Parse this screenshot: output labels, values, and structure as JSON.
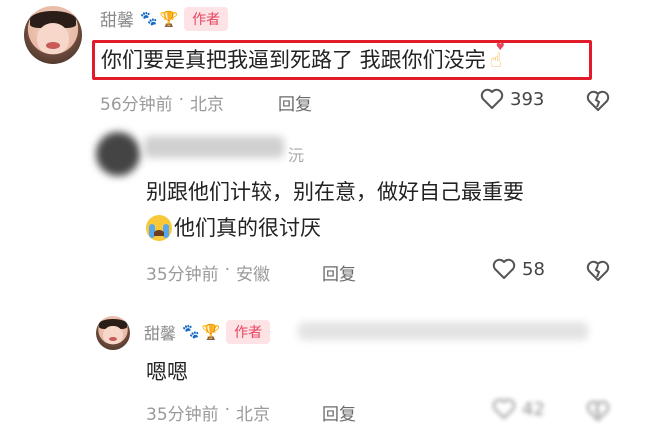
{
  "comments": [
    {
      "username": "甜馨",
      "author_label": "作者",
      "text": "你们要是真把我逼到死路了 我跟你们没完",
      "time": "56分钟前",
      "dot": "·",
      "location": "北京",
      "reply_label": "回复",
      "likes": "393"
    },
    {
      "username_partial": "沅",
      "text_line1": "别跟他们计较，别在意，做好自己最重要",
      "text_line2": "他们真的很讨厌",
      "time": "35分钟前",
      "dot": "·",
      "location": "安徽",
      "reply_label": "回复",
      "likes": "58"
    },
    {
      "username": "甜馨",
      "author_label": "作者",
      "text": "嗯嗯",
      "time": "35分钟前",
      "dot": "·",
      "location": "北京",
      "reply_label": "回复",
      "likes": "42"
    }
  ],
  "colors": {
    "highlight_border": "#e21b2b",
    "author_badge_bg": "#fde2e6",
    "author_badge_text": "#e8455f"
  },
  "icons": [
    "paw-icon",
    "trophy-icon",
    "heart-icon",
    "broken-heart-icon",
    "crying-emoji-icon",
    "finger-heart-emoji-icon"
  ]
}
